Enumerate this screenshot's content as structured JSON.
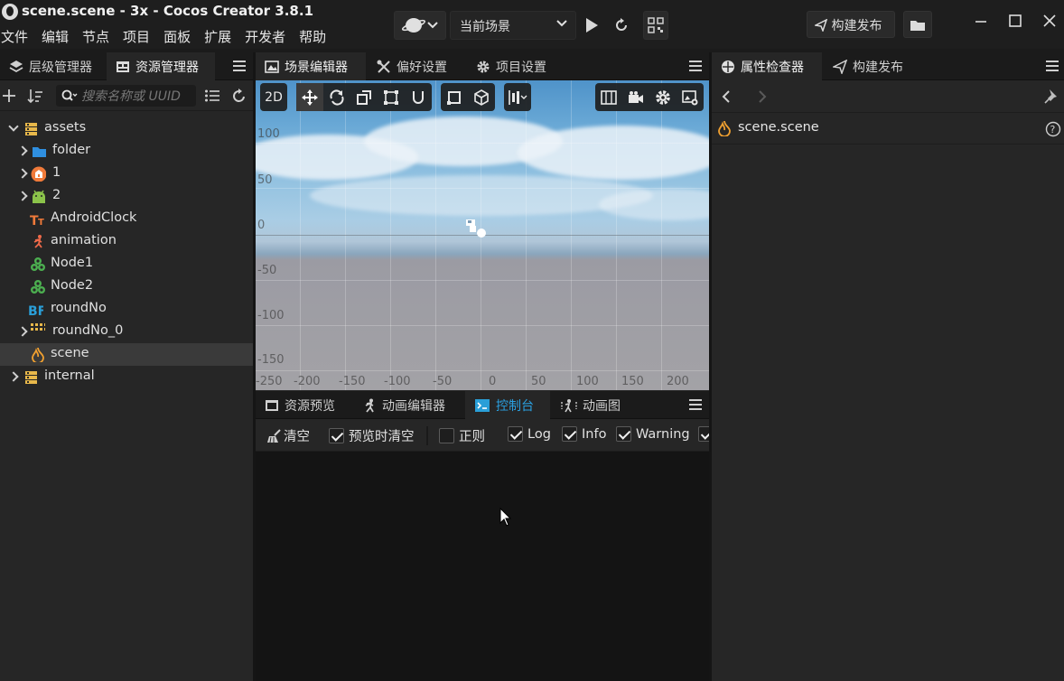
{
  "window": {
    "title": "scene.scene - 3x - Cocos Creator 3.8.1"
  },
  "menu": [
    "文件",
    "编辑",
    "节点",
    "项目",
    "面板",
    "扩展",
    "开发者",
    "帮助"
  ],
  "toolbar": {
    "scene_select": "当前场景",
    "build_label": "构建发布",
    "icons": [
      "globe-icon",
      "play-icon",
      "refresh-icon",
      "qrcode-icon",
      "folder-icon"
    ]
  },
  "left_panel": {
    "tabs": [
      {
        "label": "层级管理器",
        "icon": "layers-icon"
      },
      {
        "label": "资源管理器",
        "icon": "assets-icon",
        "active": true
      }
    ],
    "search_placeholder": "搜索名称或 UUID",
    "tree": [
      {
        "label": "assets",
        "icon": "db-icon",
        "expanded": true,
        "depth": 0
      },
      {
        "label": "folder",
        "icon": "folder-icon",
        "collapsed": true,
        "depth": 1
      },
      {
        "label": "1",
        "icon": "bundle-icon",
        "collapsed": true,
        "depth": 1
      },
      {
        "label": "2",
        "icon": "android-icon",
        "collapsed": true,
        "depth": 1
      },
      {
        "label": "AndroidClock",
        "icon": "font-icon",
        "depth": 1
      },
      {
        "label": "animation",
        "icon": "animation-icon",
        "depth": 1
      },
      {
        "label": "Node1",
        "icon": "prefab-icon",
        "depth": 1
      },
      {
        "label": "Node2",
        "icon": "prefab-icon",
        "depth": 1
      },
      {
        "label": "roundNo",
        "icon": "bitmap-font-icon",
        "depth": 1
      },
      {
        "label": "roundNo_0",
        "icon": "atlas-icon",
        "collapsed": true,
        "depth": 1
      },
      {
        "label": "scene",
        "icon": "scene-icon",
        "depth": 1,
        "selected": true
      },
      {
        "label": "internal",
        "icon": "db-icon",
        "collapsed": true,
        "depth": 0
      }
    ]
  },
  "scene_panel": {
    "tabs": [
      {
        "label": "场景编辑器",
        "icon": "scene-editor-icon",
        "active": true
      },
      {
        "label": "偏好设置",
        "icon": "tools-icon"
      },
      {
        "label": "项目设置",
        "icon": "gear-icon"
      }
    ],
    "mode_label": "2D",
    "y_labels": [
      "100",
      "50",
      "0",
      "-50",
      "-100",
      "-150"
    ],
    "x_labels": [
      "-250",
      "-200",
      "-150",
      "-100",
      "-50",
      "0",
      "50",
      "100",
      "150",
      "200"
    ]
  },
  "console_panel": {
    "tabs": [
      {
        "label": "资源预览",
        "icon": "preview-icon"
      },
      {
        "label": "动画编辑器",
        "icon": "anim-editor-icon"
      },
      {
        "label": "控制台",
        "icon": "console-icon",
        "active": true
      },
      {
        "label": "动画图",
        "icon": "anim-graph-icon"
      }
    ],
    "clear_label": "清空",
    "options": [
      {
        "label": "预览时清空",
        "checked": true
      },
      {
        "label": "正则",
        "checked": false
      },
      {
        "label": "Log",
        "checked": true
      },
      {
        "label": "Info",
        "checked": true
      },
      {
        "label": "Warning",
        "checked": true
      }
    ]
  },
  "inspector": {
    "tabs": [
      {
        "label": "属性检查器",
        "icon": "inspector-icon",
        "active": true
      },
      {
        "label": "构建发布",
        "icon": "send-icon"
      }
    ],
    "asset_name": "scene.scene"
  }
}
